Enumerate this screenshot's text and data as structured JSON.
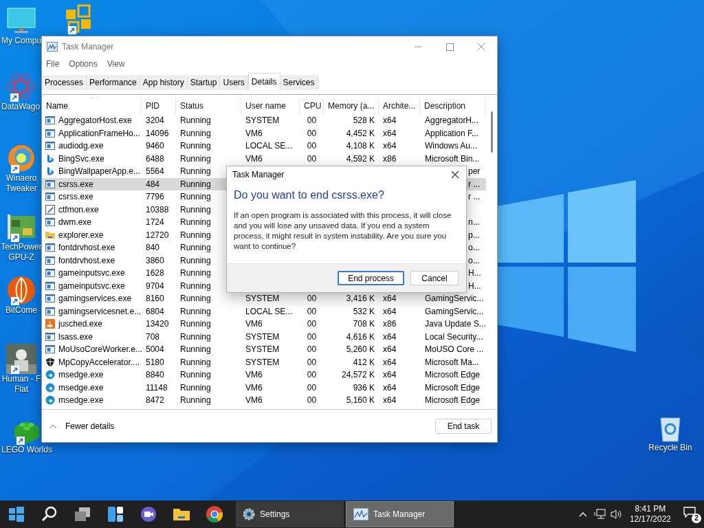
{
  "desktop_icons": [
    {
      "kind": "monitor",
      "label_lines": [
        "My Compu"
      ],
      "shortcut": false
    },
    {
      "kind": "tiles",
      "shortcut": true
    },
    {
      "kind": "atom",
      "label_lines": [
        "DataWago"
      ],
      "shortcut": true
    },
    {
      "kind": "swirl",
      "label_lines": [
        "Winaero",
        "Tweaker"
      ],
      "shortcut": true
    },
    {
      "kind": "board",
      "label_lines": [
        "TechPower",
        "GPU-Z"
      ],
      "shortcut": true
    },
    {
      "kind": "fan",
      "label_lines": [
        "BitCome"
      ],
      "shortcut": true
    },
    {
      "label_lines": [
        "Human - F",
        "Flat"
      ],
      "shortcut": true
    },
    {
      "kind": "brick",
      "label_lines": [
        "LEGO Worlds"
      ],
      "shortcut": true
    },
    {
      "kind": "bin",
      "label_lines": [
        "Recycle Bin"
      ],
      "shortcut": false
    }
  ],
  "window": {
    "title": "Task Manager",
    "menu": [
      "File",
      "Options",
      "View"
    ],
    "tabs": [
      {
        "label": "Processes",
        "selected": false
      },
      {
        "label": "Performance",
        "selected": false
      },
      {
        "label": "App history",
        "selected": false
      },
      {
        "label": "Startup",
        "selected": false
      },
      {
        "label": "Users",
        "selected": false
      },
      {
        "label": "Details",
        "selected": true
      },
      {
        "label": "Services",
        "selected": false
      }
    ],
    "columns": [
      {
        "label": "Name",
        "sorted": true
      },
      {
        "label": "PID",
        "sorted": false
      },
      {
        "label": "Status",
        "sorted": false
      },
      {
        "label": "User name",
        "sorted": false
      },
      {
        "label": "CPU",
        "sorted": false
      },
      {
        "label": "Memory (a...",
        "sorted": false
      },
      {
        "label": "Archite...",
        "sorted": false
      },
      {
        "label": "Description",
        "sorted": false
      }
    ],
    "rows": [
      {
        "kind": "app",
        "name": "AggregatorHost.exe",
        "pid": "3204",
        "status": "Running",
        "user": "SYSTEM",
        "cpu": "00",
        "memory": "528 K",
        "arch": "x64",
        "description": "AggregatorH...",
        "selected": false
      },
      {
        "kind": "app",
        "name": "ApplicationFrameHo...",
        "pid": "14096",
        "status": "Running",
        "user": "VM6",
        "cpu": "00",
        "memory": "4,452 K",
        "arch": "x64",
        "description": "Application F...",
        "selected": false
      },
      {
        "kind": "app",
        "name": "audiodg.exe",
        "pid": "9460",
        "status": "Running",
        "user": "LOCAL SE...",
        "cpu": "00",
        "memory": "4,108 K",
        "arch": "x64",
        "description": "Windows Au...",
        "selected": false
      },
      {
        "kind": "bing",
        "name": "BingSvc.exe",
        "pid": "6488",
        "status": "Running",
        "user": "VM6",
        "cpu": "00",
        "memory": "4,592 K",
        "arch": "x86",
        "description": "Microsoft Bin...",
        "selected": false
      },
      {
        "kind": "bing",
        "name": "BingWallpaperApp.e...",
        "pid": "5564",
        "status": "Running",
        "description": "per",
        "selected": false
      },
      {
        "kind": "app",
        "name": "csrss.exe",
        "pid": "484",
        "status": "Running",
        "description": "r ...",
        "selected": true
      },
      {
        "kind": "app",
        "name": "csrss.exe",
        "pid": "7796",
        "status": "Running",
        "description": "r ...",
        "selected": false
      },
      {
        "kind": "pen",
        "name": "ctfmon.exe",
        "pid": "10388",
        "status": "Running",
        "selected": false
      },
      {
        "kind": "app",
        "name": "dwm.exe",
        "pid": "1724",
        "status": "Running",
        "description": "n...",
        "selected": false
      },
      {
        "kind": "folder",
        "name": "explorer.exe",
        "pid": "12720",
        "status": "Running",
        "description": "p...",
        "selected": false
      },
      {
        "kind": "app",
        "name": "fontdrvhost.exe",
        "pid": "840",
        "status": "Running",
        "description": "o...",
        "selected": false
      },
      {
        "kind": "app",
        "name": "fontdrvhost.exe",
        "pid": "3860",
        "status": "Running",
        "description": "o...",
        "selected": false
      },
      {
        "kind": "app",
        "name": "gameinputsvc.exe",
        "pid": "1628",
        "status": "Running",
        "description": "H...",
        "selected": false
      },
      {
        "kind": "app",
        "name": "gameinputsvc.exe",
        "pid": "9704",
        "status": "Running",
        "description": "H...",
        "selected": false
      },
      {
        "kind": "app",
        "name": "gamingservices.exe",
        "pid": "8160",
        "status": "Running",
        "user": "SYSTEM",
        "cpu": "00",
        "memory": "3,416 K",
        "arch": "x64",
        "description": "GamingServic...",
        "selected": false
      },
      {
        "kind": "app",
        "name": "gamingservicesnet.e...",
        "pid": "6804",
        "status": "Running",
        "user": "LOCAL SE...",
        "cpu": "00",
        "memory": "532 K",
        "arch": "x64",
        "description": "GamingServic...",
        "selected": false
      },
      {
        "kind": "java",
        "name": "jusched.exe",
        "pid": "13420",
        "status": "Running",
        "user": "VM6",
        "cpu": "00",
        "memory": "708 K",
        "arch": "x86",
        "description": "Java Update S...",
        "selected": false
      },
      {
        "kind": "app",
        "name": "lsass.exe",
        "pid": "708",
        "status": "Running",
        "user": "SYSTEM",
        "cpu": "00",
        "memory": "4,616 K",
        "arch": "x64",
        "description": "Local Security...",
        "selected": false
      },
      {
        "kind": "app",
        "name": "MoUsoCoreWorker.e...",
        "pid": "5004",
        "status": "Running",
        "user": "SYSTEM",
        "cpu": "00",
        "memory": "5,260 K",
        "arch": "x64",
        "description": "MoUSO Core ...",
        "selected": false
      },
      {
        "kind": "shield",
        "name": "MpCopyAccelerator....",
        "pid": "5180",
        "status": "Running",
        "user": "SYSTEM",
        "cpu": "00",
        "memory": "412 K",
        "arch": "x64",
        "description": "Microsoft Ma...",
        "selected": false
      },
      {
        "kind": "edge",
        "name": "msedge.exe",
        "pid": "8840",
        "status": "Running",
        "user": "VM6",
        "cpu": "00",
        "memory": "24,572 K",
        "arch": "x64",
        "description": "Microsoft Edge",
        "selected": false
      },
      {
        "kind": "edge",
        "name": "msedge.exe",
        "pid": "11148",
        "status": "Running",
        "user": "VM6",
        "cpu": "00",
        "memory": "936 K",
        "arch": "x64",
        "description": "Microsoft Edge",
        "selected": false
      },
      {
        "kind": "edge",
        "name": "msedge.exe",
        "pid": "8472",
        "status": "Running",
        "user": "VM6",
        "cpu": "00",
        "memory": "5,160 K",
        "arch": "x64",
        "description": "Microsoft Edge",
        "selected": false
      }
    ],
    "fewer_details": "Fewer details",
    "end_task": "End task"
  },
  "dialog": {
    "title": "Task Manager",
    "heading": "Do you want to end csrss.exe?",
    "body": "If an open program is associated with this process, it will close and you will lose any unsaved data. If you end a system process, it might result in system instability. Are you sure you want to continue?",
    "buttons": [
      {
        "label": "End process",
        "default": true
      },
      {
        "label": "Cancel",
        "default": false
      }
    ]
  },
  "taskbar": {
    "apps": [
      {
        "label": "Settings",
        "kind": "settings",
        "active": false
      },
      {
        "label": "Task Manager",
        "kind": "taskmgr",
        "active": true
      }
    ],
    "time": "8:41 PM",
    "date": "12/17/2022",
    "notifications": "2"
  }
}
